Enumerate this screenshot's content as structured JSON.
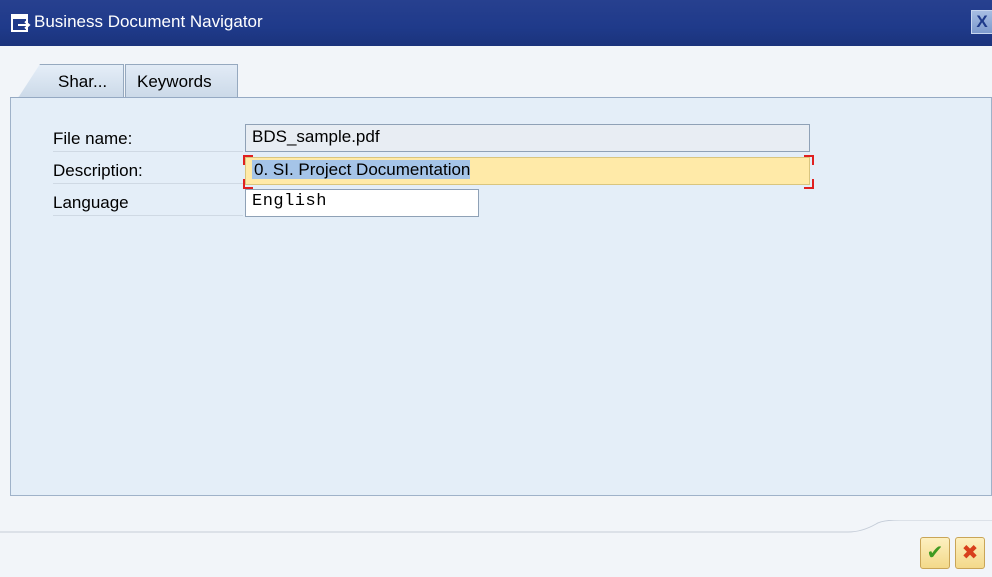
{
  "window": {
    "title": "Business Document Navigator",
    "close_label": "X"
  },
  "tabs": [
    {
      "label": "Shar...",
      "active": true
    },
    {
      "label": "Keywords",
      "active": false
    }
  ],
  "form": {
    "file_name_label": "File name:",
    "file_name_value": "BDS_sample.pdf",
    "description_label": "Description:",
    "description_value": "0. SI. Project Documentation",
    "language_label": "Language",
    "language_value": "English"
  },
  "footer": {
    "ok_icon": "✔",
    "cancel_icon": "✖"
  },
  "colors": {
    "titlebar": "#1f3a8a",
    "panel": "#e4eef8",
    "focused_field": "#ffeaa8"
  }
}
